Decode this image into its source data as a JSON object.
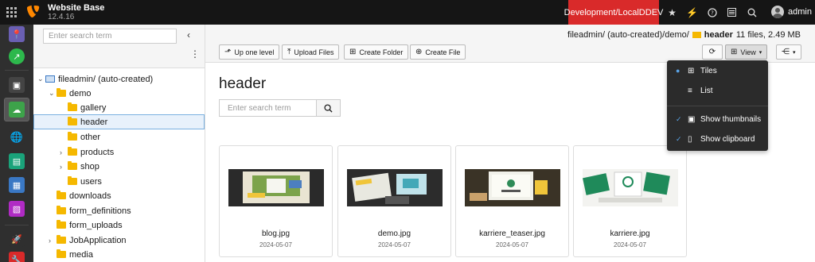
{
  "topbar": {
    "site_name": "Website Base",
    "version": "12.4.16",
    "environment": "Development/LocalDDEV",
    "username": "admin",
    "icons": [
      "star-icon",
      "bolt-icon",
      "help-icon",
      "system-info-icon",
      "search-icon"
    ],
    "env_color": "#d92a2a"
  },
  "dock": {
    "modules": [
      "page-module",
      "sites-module",
      "media-module",
      "filelist-module",
      "web-module",
      "template-module",
      "list-module",
      "forms-module",
      "launch-module",
      "tools-module"
    ]
  },
  "tree": {
    "search_placeholder": "Enter search term",
    "items": [
      {
        "label": "fileadmin/ (auto-created)"
      },
      {
        "label": "demo"
      },
      {
        "label": "gallery"
      },
      {
        "label": "header"
      },
      {
        "label": "other"
      },
      {
        "label": "products"
      },
      {
        "label": "shop"
      },
      {
        "label": "users"
      },
      {
        "label": "downloads"
      },
      {
        "label": "form_definitions"
      },
      {
        "label": "form_uploads"
      },
      {
        "label": "JobApplication"
      },
      {
        "label": "media"
      }
    ]
  },
  "main": {
    "path_prefix": "fileadmin/ (auto-created)/demo/",
    "path_current": "header",
    "path_info": "11 files, 2.49 MB",
    "buttons": {
      "up": "Up one level",
      "upload": "Upload Files",
      "create_folder": "Create Folder",
      "create_file": "Create File",
      "view": "View"
    },
    "title": "header",
    "search_placeholder": "Enter search term",
    "tiles": [
      {
        "name": "blog.jpg",
        "date": "2024-05-07"
      },
      {
        "name": "demo.jpg",
        "date": "2024-05-07"
      },
      {
        "name": "karriere_teaser.jpg",
        "date": "2024-05-07"
      },
      {
        "name": "karriere.jpg",
        "date": "2024-05-07"
      }
    ]
  },
  "view_menu": {
    "items": [
      {
        "label": "Tiles",
        "icon": "tiles-icon",
        "selected": true
      },
      {
        "label": "List",
        "icon": "list-icon",
        "selected": false
      },
      {
        "label": "Show thumbnails",
        "icon": "image-icon",
        "checked": true
      },
      {
        "label": "Show clipboard",
        "icon": "clipboard-icon",
        "checked": true
      }
    ]
  }
}
